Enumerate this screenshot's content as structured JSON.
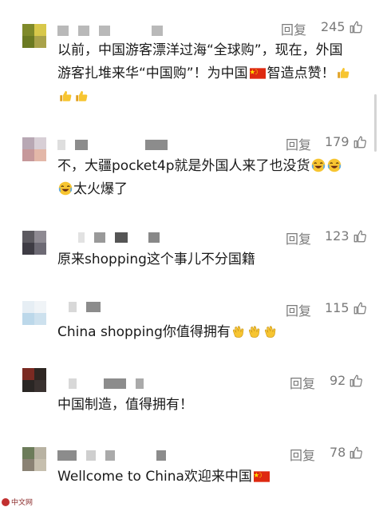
{
  "comments": [
    {
      "reply_label": "回复",
      "likes": "245",
      "line1": "以前，中国游客漂洋过海“全球购”，现在，外国",
      "line2a": "游客扎堆来华“中国购”！为中国",
      "line2b": "智造点赞！"
    },
    {
      "reply_label": "回复",
      "likes": "179",
      "line1": "不，大疆pocket4p就是外国人来了也没货",
      "line2": "太火爆了"
    },
    {
      "reply_label": "回复",
      "likes": "123",
      "line1": "原来shopping这个事儿不分国籍"
    },
    {
      "reply_label": "回复",
      "likes": "115",
      "line1": "China shopping你值得拥有"
    },
    {
      "reply_label": "回复",
      "likes": "92",
      "line1": "中国制造，值得拥有！"
    },
    {
      "reply_label": "回复",
      "likes": "78",
      "line1": "Wellcome to China欢迎来中国"
    }
  ],
  "watermark": "中文网",
  "icons": {
    "like": "thumbs-up-icon",
    "flag": "china-flag-icon",
    "laugh": "laughing-emoji-icon",
    "clap": "clapping-emoji-icon",
    "thumbs_emoji": "thumbs-up-emoji-icon"
  },
  "colors": {
    "meta_text": "#7a7a7a",
    "body_text": "#1a1a1a",
    "flag_red": "#de2910",
    "flag_star": "#ffde00"
  }
}
